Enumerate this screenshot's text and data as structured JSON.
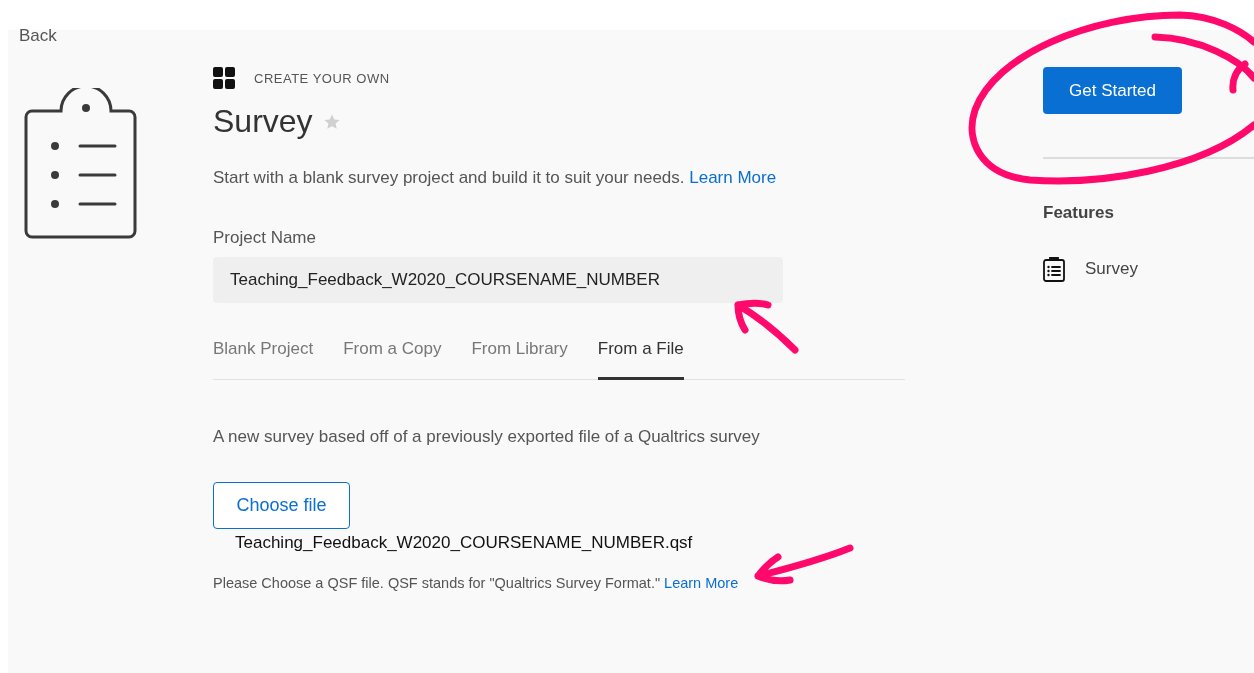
{
  "back_link": "Back",
  "header": {
    "category": "CREATE YOUR OWN",
    "title": "Survey",
    "starred": false
  },
  "description": {
    "text": "Start with a blank survey project and build it to suit your needs.",
    "link": "Learn More"
  },
  "project_name": {
    "label": "Project Name",
    "value": "Teaching_Feedback_W2020_COURSENAME_NUMBER"
  },
  "tabs": [
    {
      "label": "Blank Project",
      "selected": false
    },
    {
      "label": "From a Copy",
      "selected": false
    },
    {
      "label": "From Library",
      "selected": false
    },
    {
      "label": "From a File",
      "selected": true
    }
  ],
  "file_section": {
    "description": "A new survey based off of a previously exported file of a Qualtrics survey",
    "button": "Choose file",
    "file_name": "Teaching_Feedback_W2020_COURSENAME_NUMBER.qsf",
    "help": "Please Choose a QSF file. QSF stands for \"Qualtrics Survey Format.\"",
    "help_link": "Learn More"
  },
  "primary_button": "Get Started",
  "features": {
    "heading": "Features",
    "items": [
      "Survey"
    ]
  }
}
